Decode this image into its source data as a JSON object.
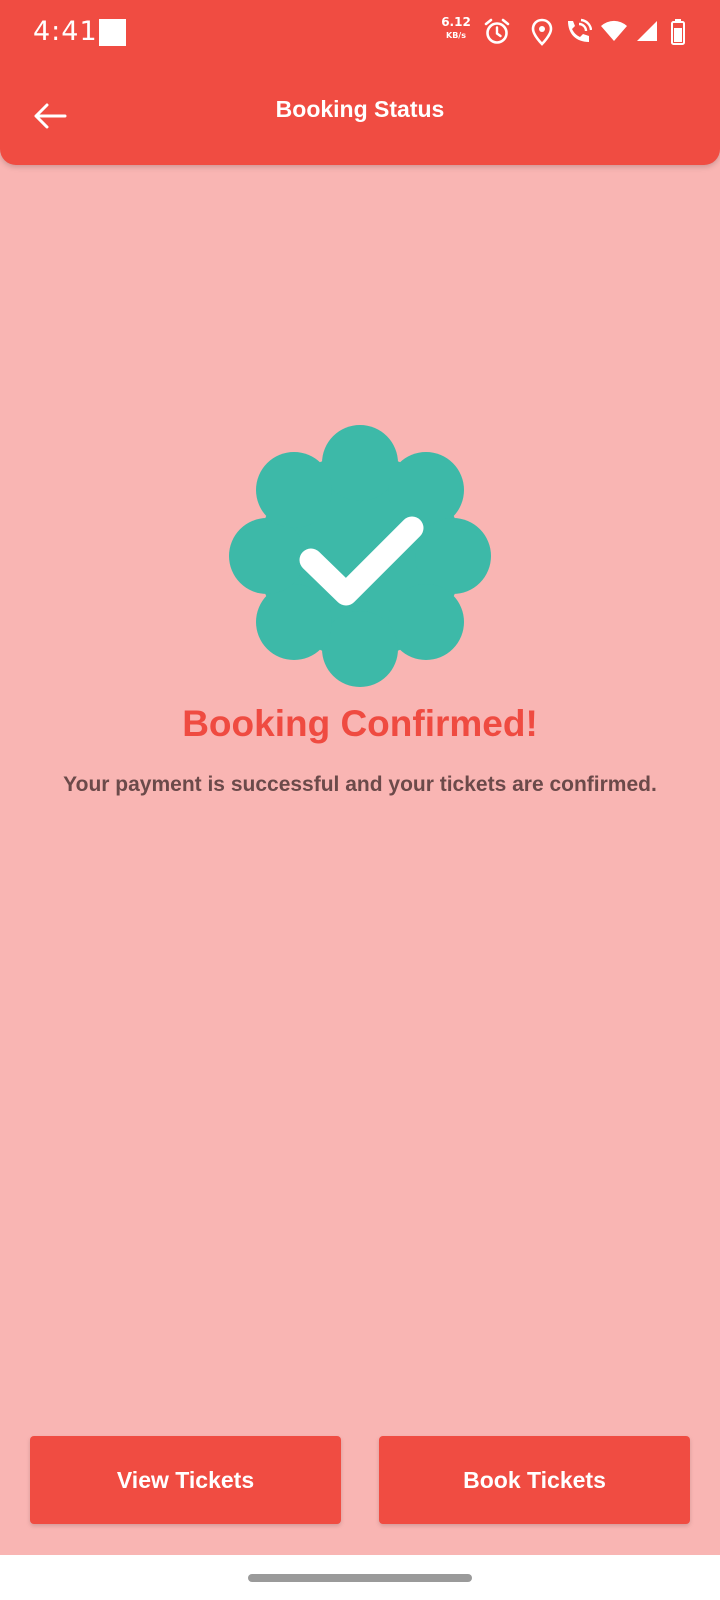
{
  "status_bar": {
    "time": "4:41",
    "net_speed_value": "6.12",
    "net_speed_unit": "KB/s",
    "icons": [
      "alarm-icon",
      "location-icon",
      "wifi-calling-icon",
      "wifi-icon",
      "signal-icon",
      "battery-icon"
    ]
  },
  "toolbar": {
    "title": "Booking Status",
    "back_icon": "arrow-left-icon"
  },
  "status": {
    "badge_icon": "verified-check-badge-icon",
    "title": "Booking Confirmed!",
    "message": "Your payment is successful and your tickets are confirmed."
  },
  "actions": {
    "view_tickets_label": "View Tickets",
    "book_tickets_label": "Book Tickets"
  },
  "colors": {
    "primary": "#f04c42",
    "background": "#f9b5b3",
    "badge": "#3db9a8",
    "message_text": "#6b4a4a"
  }
}
